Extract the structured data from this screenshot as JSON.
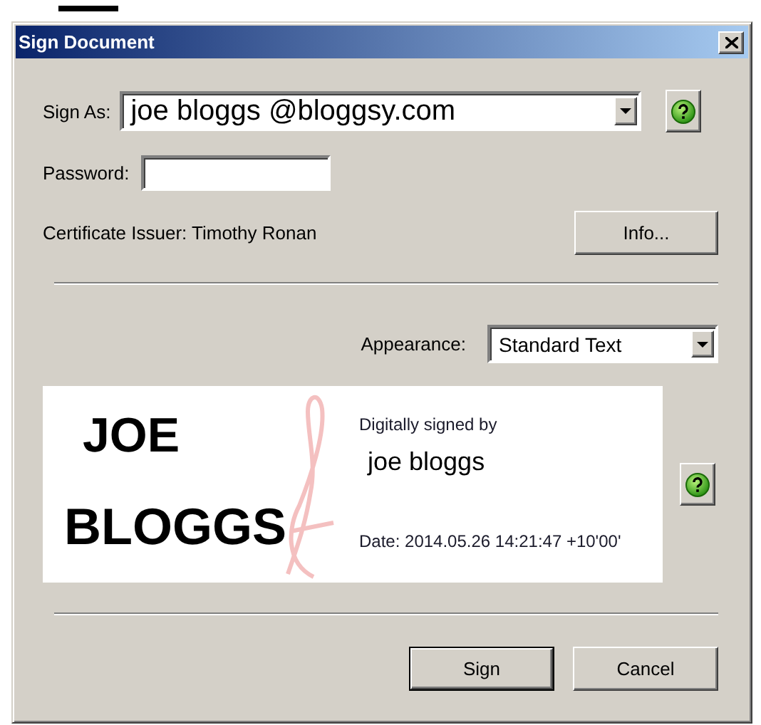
{
  "window": {
    "title": "Sign Document"
  },
  "sign_as": {
    "label": "Sign As:",
    "value": "joe bloggs @bloggsy.com"
  },
  "password": {
    "label": "Password:"
  },
  "certificate_issuer": "Certificate Issuer: Timothy Ronan",
  "info_button": "Info...",
  "appearance": {
    "label": "Appearance:",
    "value": "Standard Text"
  },
  "preview": {
    "name_lines": [
      "JOE",
      "BLOGGS"
    ],
    "caption": "Digitally signed by",
    "signer": "joe bloggs",
    "date": "Date: 2014.05.26 14:21:47 +10'00'"
  },
  "buttons": [
    {
      "label": "Sign",
      "default": true
    },
    {
      "label": "Cancel",
      "default": false
    }
  ]
}
